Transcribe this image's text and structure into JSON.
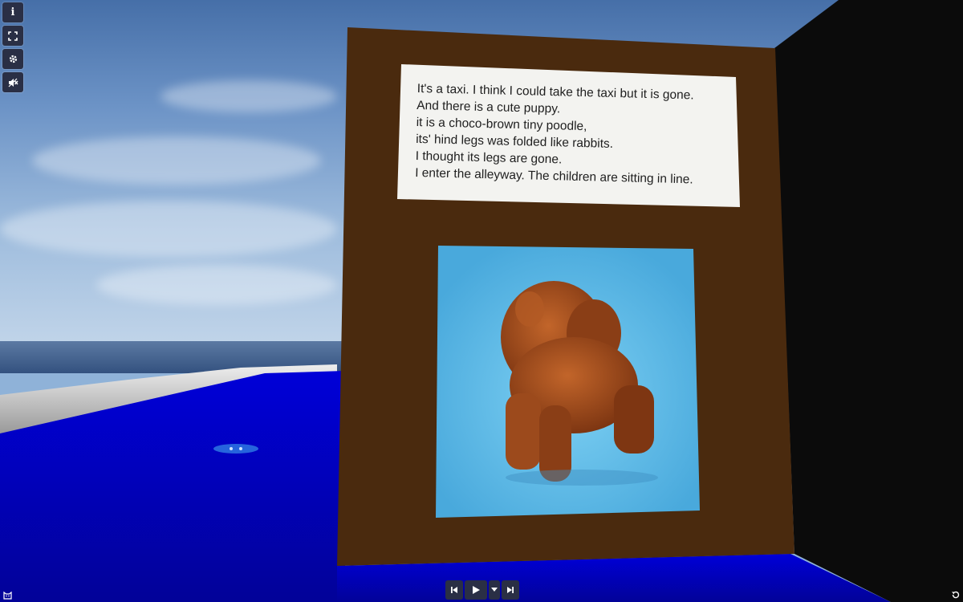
{
  "toolbar": {
    "items": [
      {
        "name": "info-icon",
        "glyph": "i"
      },
      {
        "name": "fullscreen-icon",
        "glyph": "⛶"
      },
      {
        "name": "gear-icon",
        "glyph": "⚙"
      },
      {
        "name": "sound-off-icon",
        "glyph": "🔇"
      }
    ]
  },
  "board": {
    "text_lines": [
      "It's a taxi. I think I could take the taxi but it is  gone.",
      "And there is a cute puppy.",
      "it is a choco-brown tiny poodle,",
      "its' hind legs was folded like rabbits.",
      "I thought its legs are gone.",
      "I enter the alleyway. The children are sitting in line."
    ],
    "image_icon": "poodle-image",
    "colors": {
      "frame": "#4a2a0e",
      "text_card": "#f3f3f0",
      "image_background": "#5bb8e6",
      "poodle_fur": "#9c4a1c"
    }
  },
  "world_colors": {
    "floor": "#0303c0",
    "wall": "#0b0b0b",
    "ledge": "#d8d8d8"
  },
  "player_controls": {
    "prev_icon": "skip-back-icon",
    "play_icon": "play-icon",
    "dropdown_icon": "caret-down-icon",
    "next_icon": "skip-forward-icon"
  },
  "corner_icons": {
    "left": "cat-face-icon",
    "right": "reset-view-icon"
  }
}
